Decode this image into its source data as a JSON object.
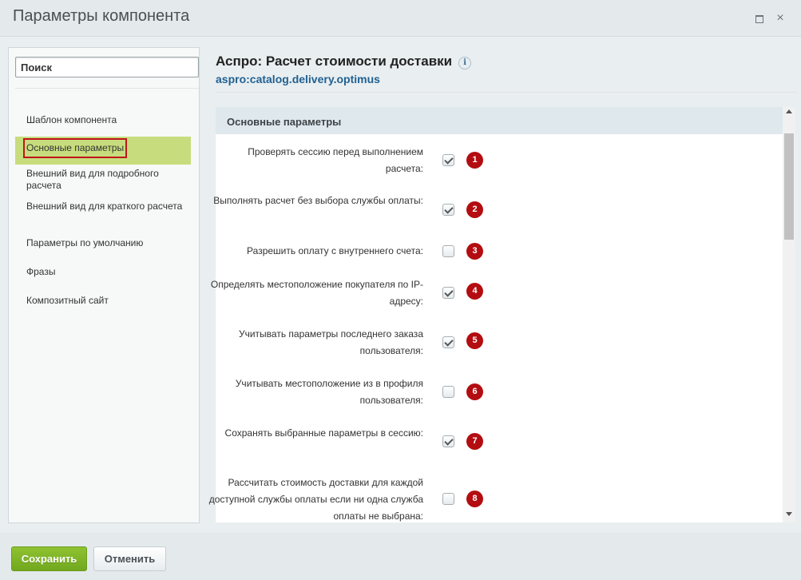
{
  "window": {
    "title": "Параметры компонента",
    "maximize_icon": "maximize-icon",
    "close_glyph": "×"
  },
  "search": {
    "placeholder": "Поиск"
  },
  "nav": {
    "items": [
      {
        "label": "Шаблон компонента"
      },
      {
        "label": "Основные параметры",
        "active": true
      },
      {
        "label": "Внешний вид для подробного расчета"
      },
      {
        "label": "Внешний вид для краткого расчета"
      },
      {
        "label": "Параметры по умолчанию"
      },
      {
        "label": "Фразы"
      },
      {
        "label": "Композитный сайт"
      }
    ]
  },
  "component": {
    "title": "Аспро: Расчет стоимости доставки",
    "info_glyph": "i",
    "code": "aspro:catalog.delivery.optimus"
  },
  "section": {
    "title": "Основные параметры"
  },
  "params": [
    {
      "label": "Проверять сессию перед выполнением расчета:",
      "checked": true,
      "badge": "1"
    },
    {
      "label": "Выполнять расчет без выбора службы оплаты:",
      "checked": true,
      "badge": "2"
    },
    {
      "label": "Разрешить оплату с внутреннего счета:",
      "checked": false,
      "badge": "3"
    },
    {
      "label": "Определять местоположение покупателя по IP-адресу:",
      "checked": true,
      "badge": "4"
    },
    {
      "label": "Учитывать параметры последнего заказа пользователя:",
      "checked": true,
      "badge": "5"
    },
    {
      "label": "Учитывать местоположение из в профиля пользователя:",
      "checked": false,
      "badge": "6"
    },
    {
      "label": "Сохранять выбранные параметры в сессию:",
      "checked": true,
      "badge": "7"
    },
    {
      "label": "Рассчитать стоимость доставки для каждой доступной службы оплаты если ни одна служба оплаты не выбрана:",
      "checked": false,
      "badge": "8"
    }
  ],
  "footer": {
    "save_label": "Сохранить",
    "cancel_label": "Отменить"
  },
  "colors": {
    "accent_green": "#7cb526",
    "badge_red": "#b30d11",
    "active_nav": "#c7dd7d",
    "link_blue": "#216192"
  }
}
